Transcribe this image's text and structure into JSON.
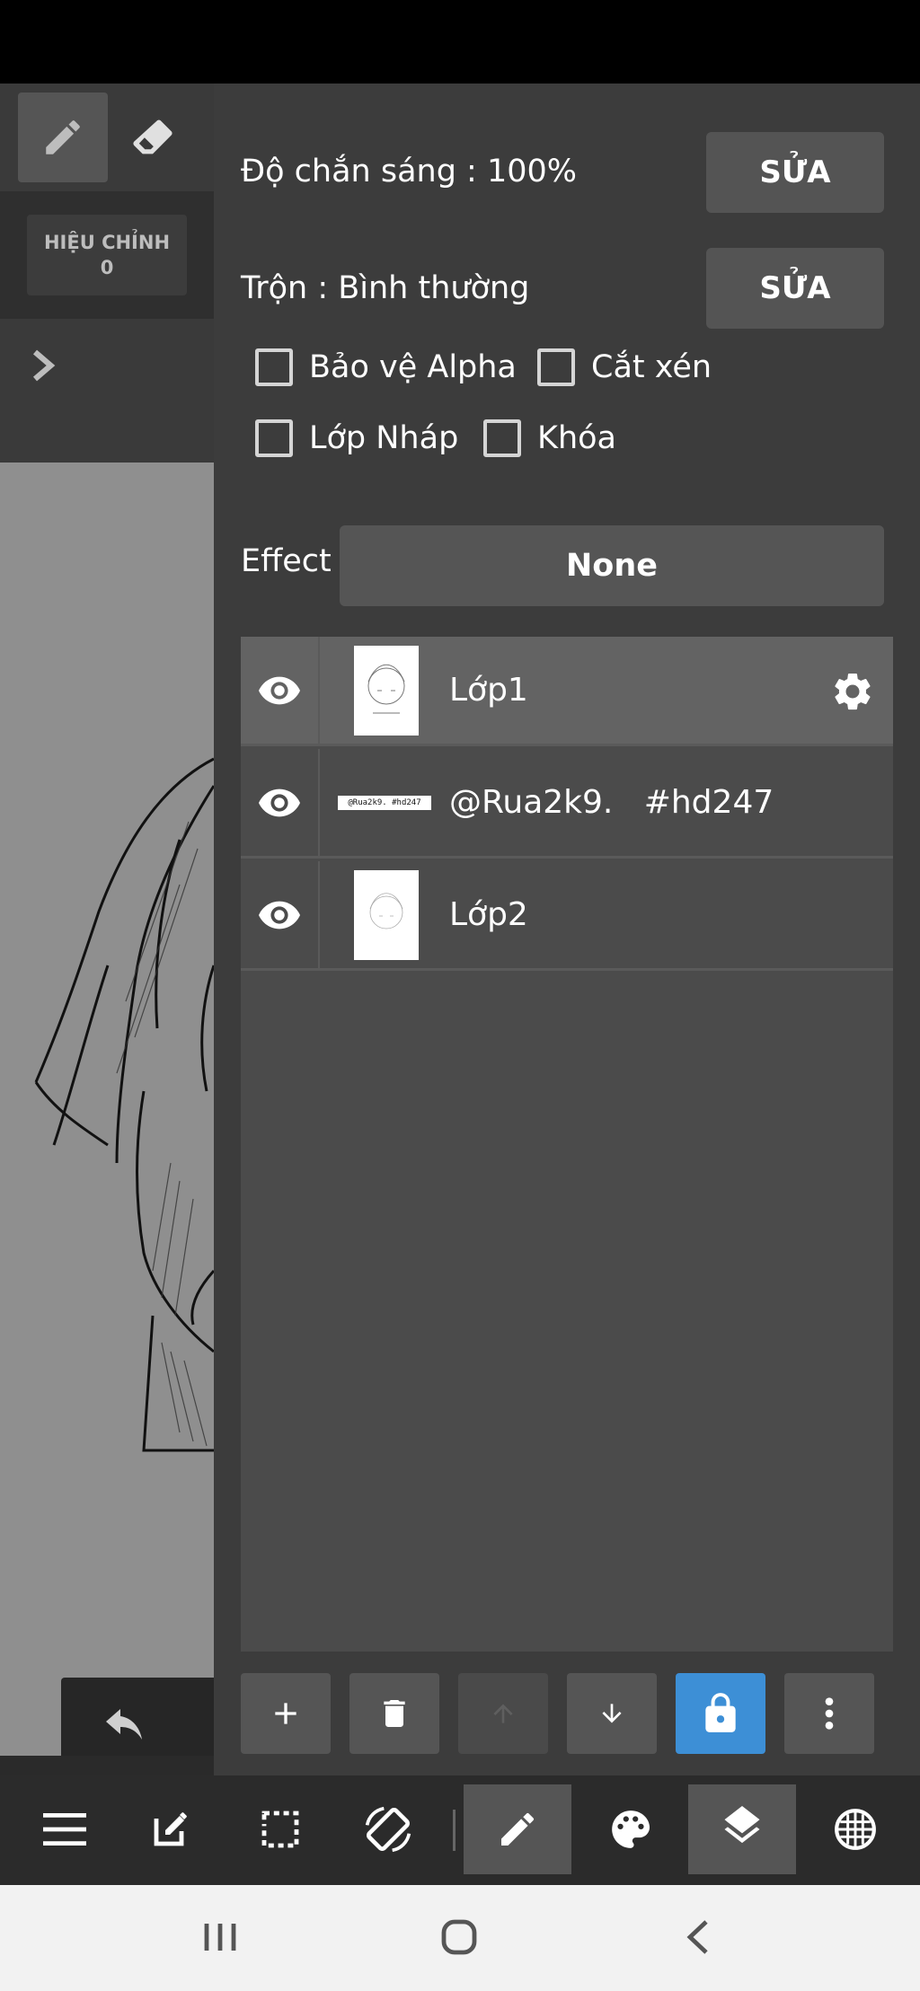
{
  "left": {
    "correction_label": "HIỆU CHỈNH",
    "correction_value": "0"
  },
  "panel": {
    "opacity_label": "Độ chắn sáng : 100%",
    "opacity_edit": "SỬA",
    "blend_label": "Trộn : Bình thường",
    "blend_edit": "SỬA",
    "checkboxes": [
      {
        "label": "Bảo vệ Alpha",
        "checked": false
      },
      {
        "label": "Cắt xén",
        "checked": false
      },
      {
        "label": "Lớp Nháp",
        "checked": false
      },
      {
        "label": "Khóa",
        "checked": false
      }
    ],
    "effect_label": "Effect",
    "effect_value": "None"
  },
  "layers": [
    {
      "name": "Lớp1",
      "selected": true,
      "visible": true,
      "thumb_text": ""
    },
    {
      "name": "@Rua2k9.   #hd247",
      "selected": false,
      "visible": true,
      "thumb_text": "@Rua2k9. #hd247"
    },
    {
      "name": "Lớp2",
      "selected": false,
      "visible": true,
      "thumb_text": ""
    }
  ],
  "colors": {
    "panel_bg": "#3c3c3c",
    "accent": "#3d8fd6",
    "selected_row": "#636363"
  },
  "icons": {
    "toolbar": [
      "pencil-icon",
      "eraser-icon"
    ],
    "actions": [
      "plus-icon",
      "trash-icon",
      "arrow-up-icon",
      "arrow-down-icon",
      "lock-icon",
      "more-vertical-icon"
    ],
    "bottom_nav": [
      "menu-icon",
      "edit-icon",
      "selection-icon",
      "rotate-icon",
      "brush-icon",
      "palette-icon",
      "layers-icon",
      "grid-icon"
    ],
    "system": [
      "recents-icon",
      "home-icon",
      "back-icon"
    ]
  }
}
